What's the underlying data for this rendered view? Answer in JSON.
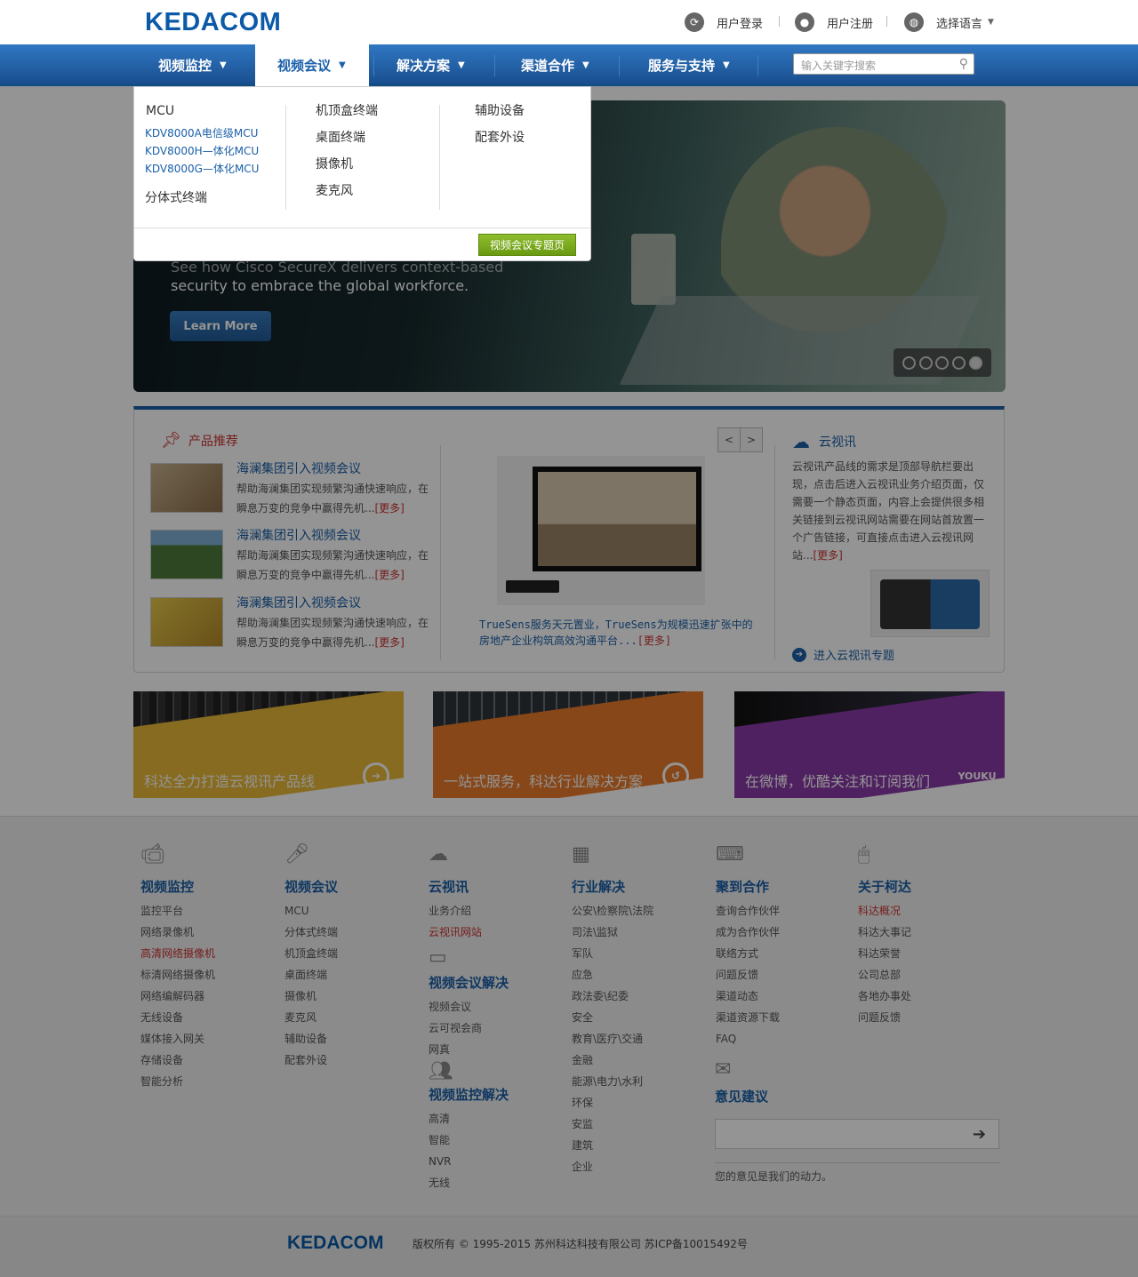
{
  "header": {
    "logo": "KEDACOM",
    "login": "用户登录",
    "register": "用户注册",
    "language": "选择语言"
  },
  "nav": {
    "items": [
      "视频监控",
      "视频会议",
      "解决方案",
      "渠道合作",
      "服务与支持"
    ],
    "active": "视频会议",
    "search_placeholder": "输入关键字搜索"
  },
  "dropdown": {
    "col1_title": "MCU",
    "col1_subs": [
      "KDV8000A电信级MCU",
      "KDV8000H—体化MCU",
      "KDV8000G—体化MCU"
    ],
    "col1_extra": "分体式终端",
    "col2": [
      "机顶盒终端",
      "桌面终端",
      "摄像机",
      "麦克风"
    ],
    "col3": [
      "辅助设备",
      "配套外设"
    ],
    "button": "视频会议专题页"
  },
  "banner": {
    "text1": "See how Cisco SecureX delivers context-based",
    "text2": "security to embrace the global workforce.",
    "button": "Learn More",
    "slides": 5,
    "active_slide": 5
  },
  "products": {
    "title": "产品推荐",
    "items": [
      {
        "title": "海澜集团引入视频会议",
        "desc": "帮助海澜集团实现频繁沟通快速响应，在瞬息万变的竞争中赢得先机...",
        "more": "[更多]"
      },
      {
        "title": "海澜集团引入视频会议",
        "desc": "帮助海澜集团实现频繁沟通快速响应，在瞬息万变的竞争中赢得先机...",
        "more": "[更多]"
      },
      {
        "title": "海澜集团引入视频会议",
        "desc": "帮助海澜集团实现频繁沟通快速响应，在瞬息万变的竞争中赢得先机...",
        "more": "[更多]"
      }
    ],
    "feature_caption": "TrueSens服务天元置业，TrueSens为规模迅速扩张中的房地产企业构筑高效沟通平台...",
    "feature_more": "[更多]",
    "prev": "<",
    "next": ">"
  },
  "cloud": {
    "title": "云视讯",
    "text": "云视讯产品线的需求是顶部导航栏要出现，点击后进入云视讯业务介绍页面，仅需要一个静态页面，内容上会提供很多相关链接到云视讯网站需要在网站首放置一个广告链接，可直接点击进入云视讯网站...",
    "more": "[更多]",
    "link": "进入云视讯专题"
  },
  "tiles": [
    {
      "text": "科达全力打造云视讯产品线",
      "color": "#e8b83a"
    },
    {
      "text": "一站式服务，科达行业解决方案",
      "color": "#e87a2a"
    },
    {
      "text": "在微博，优酷关注和订阅我们",
      "color": "#8a3aa8"
    }
  ],
  "footer": {
    "columns": [
      {
        "icon": "camera-icon",
        "title": "视频监控",
        "links": [
          "监控平台",
          "网络录像机",
          "高清网络摄像机",
          "标清网络摄像机",
          "网络编解码器",
          "无线设备",
          "媒体接入网关",
          "存储设备",
          "智能分析"
        ],
        "red_index": 2
      },
      {
        "icon": "microphone-icon",
        "title": "视频会议",
        "links": [
          "MCU",
          "分体式终端",
          "机顶盒终端",
          "桌面终端",
          "摄像机",
          "麦克风",
          "辅助设备",
          "配套外设"
        ],
        "red_index": -1
      },
      {
        "icon": "cloud-icon",
        "title": "云视讯",
        "links": [
          "业务介绍",
          "云视讯网站"
        ],
        "red_index": 1
      },
      {
        "icon": "grid-icon",
        "title": "行业解决",
        "links": [
          "公安\\检察院\\法院",
          "司法\\监狱",
          "军队",
          "应急",
          "政法委\\纪委",
          "安全",
          "教育\\医疗\\交通",
          "金融",
          "能源\\电力\\水利",
          "环保",
          "安监",
          "建筑",
          "企业"
        ],
        "red_index": -1
      },
      {
        "icon": "keyboard-icon",
        "title": "聚到合作",
        "links": [
          "查询合作伙伴",
          "成为合作伙伴",
          "联络方式",
          "问题反馈",
          "渠道动态",
          "渠道资源下载",
          "FAQ"
        ],
        "red_index": -1
      },
      {
        "icon": "mouse-icon",
        "title": "关于柯达",
        "links": [
          "科达概况",
          "科达大事记",
          "科达荣誉",
          "公司总部",
          "各地办事处",
          "问题反馈"
        ],
        "red_index": 0
      }
    ],
    "vc_solutions": {
      "title": "视频会议解决",
      "links": [
        "视频会议",
        "云可视会商",
        "网真"
      ]
    },
    "vs_solutions": {
      "title": "视频监控解决",
      "links": [
        "高清",
        "智能",
        "NVR",
        "无线"
      ]
    },
    "feedback": {
      "title": "意见建议",
      "note": "您的意见是我们的动力。"
    }
  },
  "bottom": {
    "logo": "KEDACOM",
    "copyright": "版权所有 © 1995-2015 苏州科达科技有限公司 苏ICP备10015492号"
  }
}
